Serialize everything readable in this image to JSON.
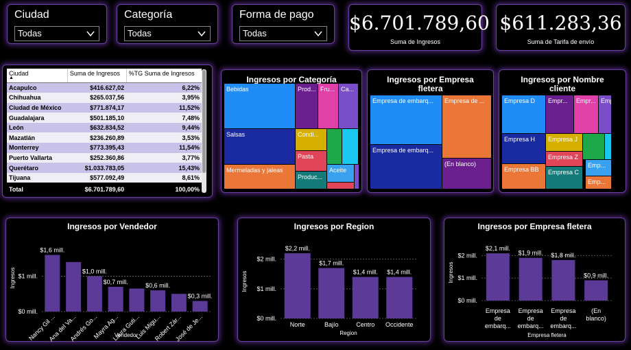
{
  "slicers": [
    {
      "title": "Ciudad",
      "value": "Todas"
    },
    {
      "title": "Categoría",
      "value": "Todas"
    },
    {
      "title": "Forma de pago",
      "value": "Todas"
    }
  ],
  "kpis": [
    {
      "value": "$6.701.789,60",
      "label": "Suma de Ingresos"
    },
    {
      "value": "$611.283,36",
      "label": "Suma de Tarifa de envío"
    }
  ],
  "table": {
    "headers": [
      "Ciudad",
      "Suma de Ingresos",
      "%TG Suma de Ingresos"
    ],
    "rows": [
      [
        "Acapulco",
        "$416.627,02",
        "6,22%"
      ],
      [
        "Chihuahua",
        "$265.037,56",
        "3,95%"
      ],
      [
        "Ciudad de México",
        "$771.874,17",
        "11,52%"
      ],
      [
        "Guadalajara",
        "$501.185,10",
        "7,48%"
      ],
      [
        "León",
        "$632.834,52",
        "9,44%"
      ],
      [
        "Mazatlán",
        "$236.260,89",
        "3,53%"
      ],
      [
        "Monterrey",
        "$773.395,43",
        "11,54%"
      ],
      [
        "Puerto Vallarta",
        "$252.360,86",
        "3,77%"
      ],
      [
        "Querétaro",
        "$1.033.783,05",
        "15,43%"
      ],
      [
        "Tijuana",
        "$577.092,49",
        "8,61%"
      ]
    ],
    "total": [
      "Total",
      "$6.701.789,60",
      "100,00%"
    ]
  },
  "treemaps": [
    {
      "title": "Ingresos por Categoría",
      "cells": [
        {
          "label": "Bebidas",
          "color": "#1f8cf8"
        },
        {
          "label": "Prod...",
          "color": "#6b1f8f"
        },
        {
          "label": "Fru...",
          "color": "#e040a8"
        },
        {
          "label": "Ca...",
          "color": "#7a4ec8"
        },
        {
          "label": "Salsas",
          "color": "#1a2aa0"
        },
        {
          "label": "Condi...",
          "color": "#d6b000"
        },
        {
          "label": "",
          "color": "#1fa84a"
        },
        {
          "label": "",
          "color": "#18c8f0"
        },
        {
          "label": "Pasta",
          "color": "#e0455a"
        },
        {
          "label": "Mermeladas y jaleas",
          "color": "#ea7638"
        },
        {
          "label": "Produc...",
          "color": "#147a7a"
        },
        {
          "label": "Aceite",
          "color": "#3aa0f0"
        },
        {
          "label": "",
          "color": "#e0455a"
        },
        {
          "label": "",
          "color": "#7a4ec8"
        }
      ]
    },
    {
      "title": "Ingresos por Empresa fletera",
      "cells": [
        {
          "label": "Empresa de embarq...",
          "color": "#1f8cf8"
        },
        {
          "label": "Empresa de ...",
          "color": "#ea7638"
        },
        {
          "label": "Empresa de embarq...",
          "color": "#1a2aa0"
        },
        {
          "label": "(En blanco)",
          "color": "#6b1f8f"
        }
      ]
    },
    {
      "title": "Ingresos por Nombre cliente",
      "cells": [
        {
          "label": "Empresa D",
          "color": "#1f8cf8"
        },
        {
          "label": "Empr...",
          "color": "#6b1f8f"
        },
        {
          "label": "Empr...",
          "color": "#e040a8"
        },
        {
          "label": "Empr...",
          "color": "#7a4ec8"
        },
        {
          "label": "Empresa H",
          "color": "#1a2aa0"
        },
        {
          "label": "Empresa J",
          "color": "#d6b000"
        },
        {
          "label": "",
          "color": "#1fa84a"
        },
        {
          "label": "",
          "color": "#18c8f0"
        },
        {
          "label": "Empresa Z",
          "color": "#e0455a"
        },
        {
          "label": "Empresa BB",
          "color": "#ea7638"
        },
        {
          "label": "Empresa C",
          "color": "#147a7a"
        },
        {
          "label": "Emp...",
          "color": "#3aa0f0"
        },
        {
          "label": "Emp...",
          "color": "#ea7638"
        }
      ]
    }
  ],
  "chart_data": [
    {
      "type": "bar",
      "title": "Ingresos por Vendedor",
      "xlabel": "Vendedor",
      "ylabel": "Ingresos",
      "categories": [
        "Nancy Gil ...",
        "Ana del Va...",
        "Andrés Go...",
        "Mayra Ag...",
        "Laura Guti...",
        "Luis Migu...",
        "Robert Zár...",
        "José de Je..."
      ],
      "values": [
        1.6,
        1.4,
        1.0,
        0.7,
        0.65,
        0.6,
        0.5,
        0.3
      ],
      "data_labels": [
        "$1,6 mill.",
        "",
        "$1,0 mill.",
        "$0,7 mill.",
        "",
        "$0,6 mill.",
        "",
        "$0,3 mill."
      ],
      "yticks": [
        0,
        1
      ],
      "ytick_labels": [
        "$0 mill.",
        "$1 mill."
      ],
      "ylim": [
        0,
        1.9
      ],
      "color": "#5b3a98"
    },
    {
      "type": "bar",
      "title": "Ingresos por Region",
      "xlabel": "Region",
      "ylabel": "Ingresos",
      "categories": [
        "Norte",
        "Bajío",
        "Centro",
        "Occidente"
      ],
      "values": [
        2.2,
        1.7,
        1.4,
        1.4
      ],
      "data_labels": [
        "$2,2 mill.",
        "$1,7 mill.",
        "$1,4 mill.",
        "$1,4 mill."
      ],
      "yticks": [
        0,
        1,
        2
      ],
      "ytick_labels": [
        "$0 mill.",
        "$1 mill.",
        "$2 mill."
      ],
      "ylim": [
        0,
        2.5
      ],
      "color": "#5b3a98"
    },
    {
      "type": "bar",
      "title": "Ingresos por Empresa fletera",
      "xlabel": "Empresa fletera",
      "ylabel": "Ingresos",
      "categories": [
        "Empresa de embarq...",
        "Empresa de embarq...",
        "Empresa de embarq...",
        "(En blanco)"
      ],
      "category_lines": [
        [
          "Empresa",
          "de",
          "embarq..."
        ],
        [
          "Empresa",
          "de",
          "embarq..."
        ],
        [
          "Empresa",
          "de",
          "embarq..."
        ],
        [
          "(En",
          "blanco)"
        ]
      ],
      "values": [
        2.1,
        1.9,
        1.8,
        0.9
      ],
      "data_labels": [
        "$2,1 mill.",
        "$1,9 mill.",
        "$1,8 mill.",
        "$0,9 mill."
      ],
      "yticks": [
        0,
        1,
        2
      ],
      "ytick_labels": [
        "$0 mill.",
        "$1 mill.",
        "$2 mill."
      ],
      "ylim": [
        0,
        2.5
      ],
      "color": "#5b3a98"
    }
  ]
}
